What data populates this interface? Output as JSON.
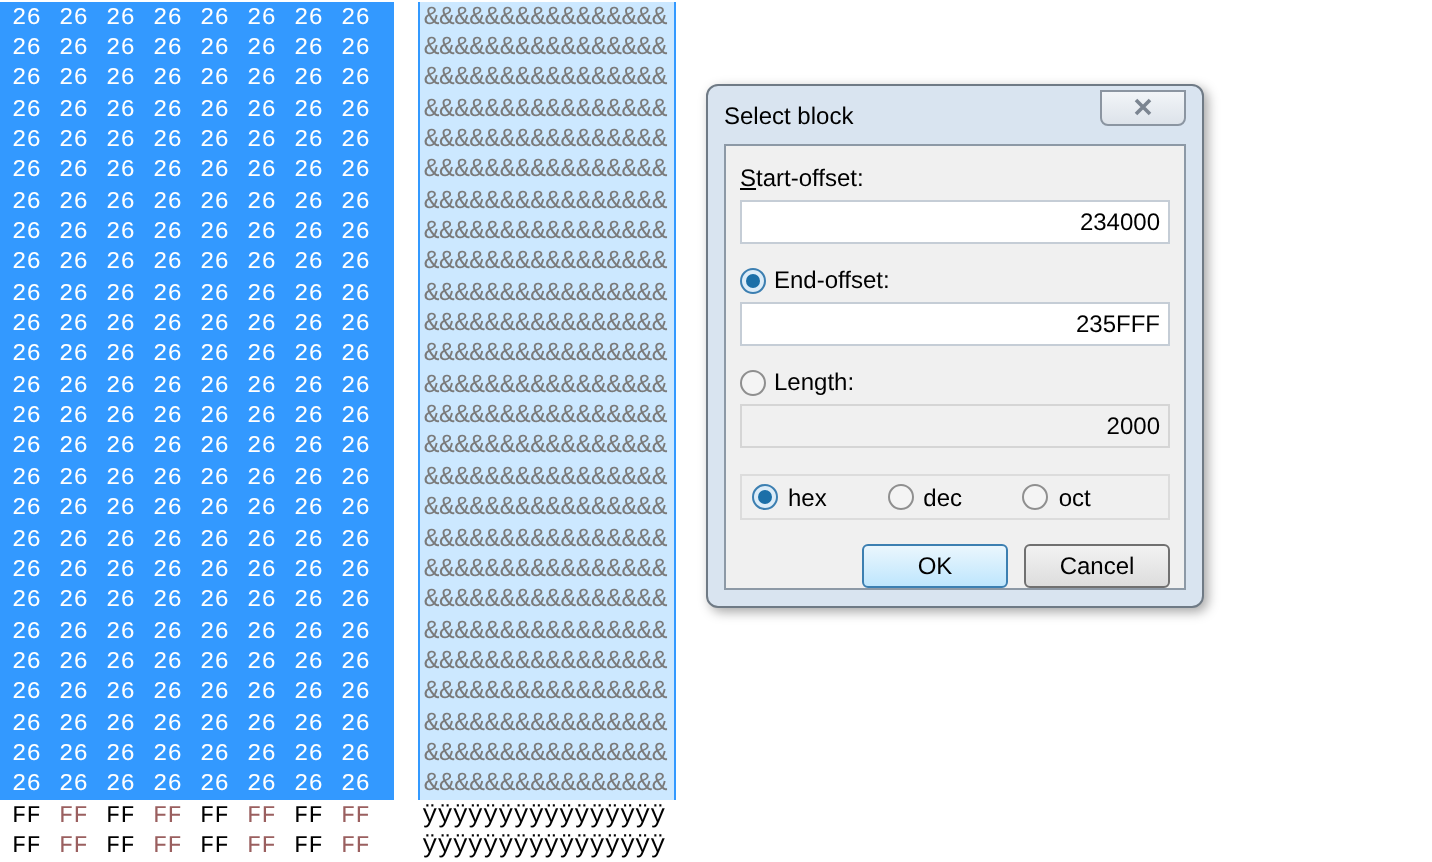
{
  "hex_rows": [
    {
      "selected": true,
      "cells": [
        "26",
        "26",
        "26",
        "26",
        "26",
        "26",
        "26",
        "26"
      ],
      "text": "&&&&&&&&&&&&&&&&"
    },
    {
      "selected": true,
      "cells": [
        "26",
        "26",
        "26",
        "26",
        "26",
        "26",
        "26",
        "26"
      ],
      "text": "&&&&&&&&&&&&&&&&"
    },
    {
      "selected": true,
      "cells": [
        "26",
        "26",
        "26",
        "26",
        "26",
        "26",
        "26",
        "26"
      ],
      "text": "&&&&&&&&&&&&&&&&"
    },
    {
      "selected": true,
      "cells": [
        "26",
        "26",
        "26",
        "26",
        "26",
        "26",
        "26",
        "26"
      ],
      "text": "&&&&&&&&&&&&&&&&"
    },
    {
      "selected": true,
      "cells": [
        "26",
        "26",
        "26",
        "26",
        "26",
        "26",
        "26",
        "26"
      ],
      "text": "&&&&&&&&&&&&&&&&"
    },
    {
      "selected": true,
      "cells": [
        "26",
        "26",
        "26",
        "26",
        "26",
        "26",
        "26",
        "26"
      ],
      "text": "&&&&&&&&&&&&&&&&"
    },
    {
      "selected": true,
      "cells": [
        "26",
        "26",
        "26",
        "26",
        "26",
        "26",
        "26",
        "26"
      ],
      "text": "&&&&&&&&&&&&&&&&"
    },
    {
      "selected": true,
      "cells": [
        "26",
        "26",
        "26",
        "26",
        "26",
        "26",
        "26",
        "26"
      ],
      "text": "&&&&&&&&&&&&&&&&"
    },
    {
      "selected": true,
      "cells": [
        "26",
        "26",
        "26",
        "26",
        "26",
        "26",
        "26",
        "26"
      ],
      "text": "&&&&&&&&&&&&&&&&"
    },
    {
      "selected": true,
      "cells": [
        "26",
        "26",
        "26",
        "26",
        "26",
        "26",
        "26",
        "26"
      ],
      "text": "&&&&&&&&&&&&&&&&"
    },
    {
      "selected": true,
      "cells": [
        "26",
        "26",
        "26",
        "26",
        "26",
        "26",
        "26",
        "26"
      ],
      "text": "&&&&&&&&&&&&&&&&"
    },
    {
      "selected": true,
      "cells": [
        "26",
        "26",
        "26",
        "26",
        "26",
        "26",
        "26",
        "26"
      ],
      "text": "&&&&&&&&&&&&&&&&"
    },
    {
      "selected": true,
      "cells": [
        "26",
        "26",
        "26",
        "26",
        "26",
        "26",
        "26",
        "26"
      ],
      "text": "&&&&&&&&&&&&&&&&"
    },
    {
      "selected": true,
      "cells": [
        "26",
        "26",
        "26",
        "26",
        "26",
        "26",
        "26",
        "26"
      ],
      "text": "&&&&&&&&&&&&&&&&"
    },
    {
      "selected": true,
      "cells": [
        "26",
        "26",
        "26",
        "26",
        "26",
        "26",
        "26",
        "26"
      ],
      "text": "&&&&&&&&&&&&&&&&"
    },
    {
      "selected": true,
      "cells": [
        "26",
        "26",
        "26",
        "26",
        "26",
        "26",
        "26",
        "26"
      ],
      "text": "&&&&&&&&&&&&&&&&"
    },
    {
      "selected": true,
      "cells": [
        "26",
        "26",
        "26",
        "26",
        "26",
        "26",
        "26",
        "26"
      ],
      "text": "&&&&&&&&&&&&&&&&"
    },
    {
      "selected": true,
      "cells": [
        "26",
        "26",
        "26",
        "26",
        "26",
        "26",
        "26",
        "26"
      ],
      "text": "&&&&&&&&&&&&&&&&"
    },
    {
      "selected": true,
      "cells": [
        "26",
        "26",
        "26",
        "26",
        "26",
        "26",
        "26",
        "26"
      ],
      "text": "&&&&&&&&&&&&&&&&"
    },
    {
      "selected": true,
      "cells": [
        "26",
        "26",
        "26",
        "26",
        "26",
        "26",
        "26",
        "26"
      ],
      "text": "&&&&&&&&&&&&&&&&"
    },
    {
      "selected": true,
      "cells": [
        "26",
        "26",
        "26",
        "26",
        "26",
        "26",
        "26",
        "26"
      ],
      "text": "&&&&&&&&&&&&&&&&"
    },
    {
      "selected": true,
      "cells": [
        "26",
        "26",
        "26",
        "26",
        "26",
        "26",
        "26",
        "26"
      ],
      "text": "&&&&&&&&&&&&&&&&"
    },
    {
      "selected": true,
      "cells": [
        "26",
        "26",
        "26",
        "26",
        "26",
        "26",
        "26",
        "26"
      ],
      "text": "&&&&&&&&&&&&&&&&"
    },
    {
      "selected": true,
      "cells": [
        "26",
        "26",
        "26",
        "26",
        "26",
        "26",
        "26",
        "26"
      ],
      "text": "&&&&&&&&&&&&&&&&"
    },
    {
      "selected": true,
      "cells": [
        "26",
        "26",
        "26",
        "26",
        "26",
        "26",
        "26",
        "26"
      ],
      "text": "&&&&&&&&&&&&&&&&"
    },
    {
      "selected": true,
      "cells": [
        "26",
        "26",
        "26",
        "26",
        "26",
        "26",
        "26",
        "26"
      ],
      "text": "&&&&&&&&&&&&&&&&"
    },
    {
      "selected": false,
      "cells": [
        "FF",
        "FF",
        "FF",
        "FF",
        "FF",
        "FF",
        "FF",
        "FF"
      ],
      "text": "ÿÿÿÿÿÿÿÿÿÿÿÿÿÿÿÿ"
    },
    {
      "selected": false,
      "cells": [
        "FF",
        "FF",
        "FF",
        "FF",
        "FF",
        "FF",
        "FF",
        "FF"
      ],
      "text": "ÿÿÿÿÿÿÿÿÿÿÿÿÿÿÿÿ"
    }
  ],
  "dialog": {
    "title": "Select block",
    "fields": [
      {
        "kind": "plain",
        "label": "Start-offset:",
        "disabled": false,
        "value": "234000"
      },
      {
        "kind": "radio",
        "label": "End-offset:",
        "selected": true,
        "disabled": false,
        "value": "235FFF"
      },
      {
        "kind": "radio",
        "label": "Length:",
        "selected": false,
        "disabled": true,
        "value": "2000"
      }
    ],
    "bases": [
      {
        "label": "hex",
        "selected": true
      },
      {
        "label": "dec",
        "selected": false
      },
      {
        "label": "oct",
        "selected": false
      }
    ],
    "buttons": [
      {
        "label": "OK",
        "default": true
      },
      {
        "label": "Cancel",
        "default": false
      }
    ]
  }
}
